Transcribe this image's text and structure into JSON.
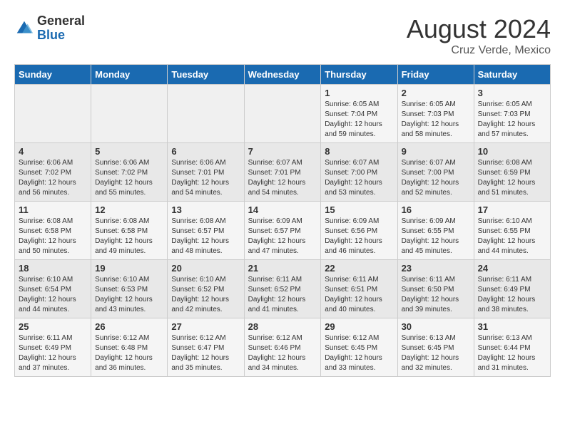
{
  "logo": {
    "general": "General",
    "blue": "Blue"
  },
  "header": {
    "title": "August 2024",
    "subtitle": "Cruz Verde, Mexico"
  },
  "weekdays": [
    "Sunday",
    "Monday",
    "Tuesday",
    "Wednesday",
    "Thursday",
    "Friday",
    "Saturday"
  ],
  "weeks": [
    [
      {
        "day": "",
        "info": ""
      },
      {
        "day": "",
        "info": ""
      },
      {
        "day": "",
        "info": ""
      },
      {
        "day": "",
        "info": ""
      },
      {
        "day": "1",
        "info": "Sunrise: 6:05 AM\nSunset: 7:04 PM\nDaylight: 12 hours and 59 minutes."
      },
      {
        "day": "2",
        "info": "Sunrise: 6:05 AM\nSunset: 7:03 PM\nDaylight: 12 hours and 58 minutes."
      },
      {
        "day": "3",
        "info": "Sunrise: 6:05 AM\nSunset: 7:03 PM\nDaylight: 12 hours and 57 minutes."
      }
    ],
    [
      {
        "day": "4",
        "info": "Sunrise: 6:06 AM\nSunset: 7:02 PM\nDaylight: 12 hours and 56 minutes."
      },
      {
        "day": "5",
        "info": "Sunrise: 6:06 AM\nSunset: 7:02 PM\nDaylight: 12 hours and 55 minutes."
      },
      {
        "day": "6",
        "info": "Sunrise: 6:06 AM\nSunset: 7:01 PM\nDaylight: 12 hours and 54 minutes."
      },
      {
        "day": "7",
        "info": "Sunrise: 6:07 AM\nSunset: 7:01 PM\nDaylight: 12 hours and 54 minutes."
      },
      {
        "day": "8",
        "info": "Sunrise: 6:07 AM\nSunset: 7:00 PM\nDaylight: 12 hours and 53 minutes."
      },
      {
        "day": "9",
        "info": "Sunrise: 6:07 AM\nSunset: 7:00 PM\nDaylight: 12 hours and 52 minutes."
      },
      {
        "day": "10",
        "info": "Sunrise: 6:08 AM\nSunset: 6:59 PM\nDaylight: 12 hours and 51 minutes."
      }
    ],
    [
      {
        "day": "11",
        "info": "Sunrise: 6:08 AM\nSunset: 6:58 PM\nDaylight: 12 hours and 50 minutes."
      },
      {
        "day": "12",
        "info": "Sunrise: 6:08 AM\nSunset: 6:58 PM\nDaylight: 12 hours and 49 minutes."
      },
      {
        "day": "13",
        "info": "Sunrise: 6:08 AM\nSunset: 6:57 PM\nDaylight: 12 hours and 48 minutes."
      },
      {
        "day": "14",
        "info": "Sunrise: 6:09 AM\nSunset: 6:57 PM\nDaylight: 12 hours and 47 minutes."
      },
      {
        "day": "15",
        "info": "Sunrise: 6:09 AM\nSunset: 6:56 PM\nDaylight: 12 hours and 46 minutes."
      },
      {
        "day": "16",
        "info": "Sunrise: 6:09 AM\nSunset: 6:55 PM\nDaylight: 12 hours and 45 minutes."
      },
      {
        "day": "17",
        "info": "Sunrise: 6:10 AM\nSunset: 6:55 PM\nDaylight: 12 hours and 44 minutes."
      }
    ],
    [
      {
        "day": "18",
        "info": "Sunrise: 6:10 AM\nSunset: 6:54 PM\nDaylight: 12 hours and 44 minutes."
      },
      {
        "day": "19",
        "info": "Sunrise: 6:10 AM\nSunset: 6:53 PM\nDaylight: 12 hours and 43 minutes."
      },
      {
        "day": "20",
        "info": "Sunrise: 6:10 AM\nSunset: 6:52 PM\nDaylight: 12 hours and 42 minutes."
      },
      {
        "day": "21",
        "info": "Sunrise: 6:11 AM\nSunset: 6:52 PM\nDaylight: 12 hours and 41 minutes."
      },
      {
        "day": "22",
        "info": "Sunrise: 6:11 AM\nSunset: 6:51 PM\nDaylight: 12 hours and 40 minutes."
      },
      {
        "day": "23",
        "info": "Sunrise: 6:11 AM\nSunset: 6:50 PM\nDaylight: 12 hours and 39 minutes."
      },
      {
        "day": "24",
        "info": "Sunrise: 6:11 AM\nSunset: 6:49 PM\nDaylight: 12 hours and 38 minutes."
      }
    ],
    [
      {
        "day": "25",
        "info": "Sunrise: 6:11 AM\nSunset: 6:49 PM\nDaylight: 12 hours and 37 minutes."
      },
      {
        "day": "26",
        "info": "Sunrise: 6:12 AM\nSunset: 6:48 PM\nDaylight: 12 hours and 36 minutes."
      },
      {
        "day": "27",
        "info": "Sunrise: 6:12 AM\nSunset: 6:47 PM\nDaylight: 12 hours and 35 minutes."
      },
      {
        "day": "28",
        "info": "Sunrise: 6:12 AM\nSunset: 6:46 PM\nDaylight: 12 hours and 34 minutes."
      },
      {
        "day": "29",
        "info": "Sunrise: 6:12 AM\nSunset: 6:45 PM\nDaylight: 12 hours and 33 minutes."
      },
      {
        "day": "30",
        "info": "Sunrise: 6:13 AM\nSunset: 6:45 PM\nDaylight: 12 hours and 32 minutes."
      },
      {
        "day": "31",
        "info": "Sunrise: 6:13 AM\nSunset: 6:44 PM\nDaylight: 12 hours and 31 minutes."
      }
    ]
  ]
}
